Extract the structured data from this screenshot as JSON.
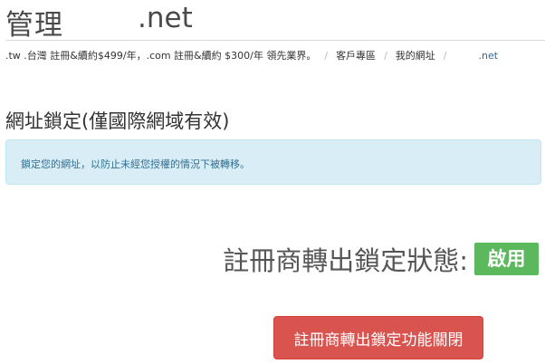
{
  "header": {
    "title": "管理",
    "domain": ".net"
  },
  "breadcrumb": {
    "promo": ".tw .台灣 註冊&續約$499/年，.com 註冊&續約 $300/年 領先業界。",
    "items": [
      "客戶專區",
      "我的網址",
      ".net"
    ],
    "separator": "/"
  },
  "section": {
    "title": "網址鎖定(僅國際網域有效)"
  },
  "alert": {
    "message": "鎖定您的網址，以防止未經您授權的情況下被轉移。"
  },
  "status": {
    "label": "註冊商轉出鎖定狀態:",
    "value": "啟用",
    "badge_color": "#5cb85c"
  },
  "actions": {
    "disable_lock_label": "註冊商轉出鎖定功能關閉",
    "button_color": "#d9534f"
  }
}
